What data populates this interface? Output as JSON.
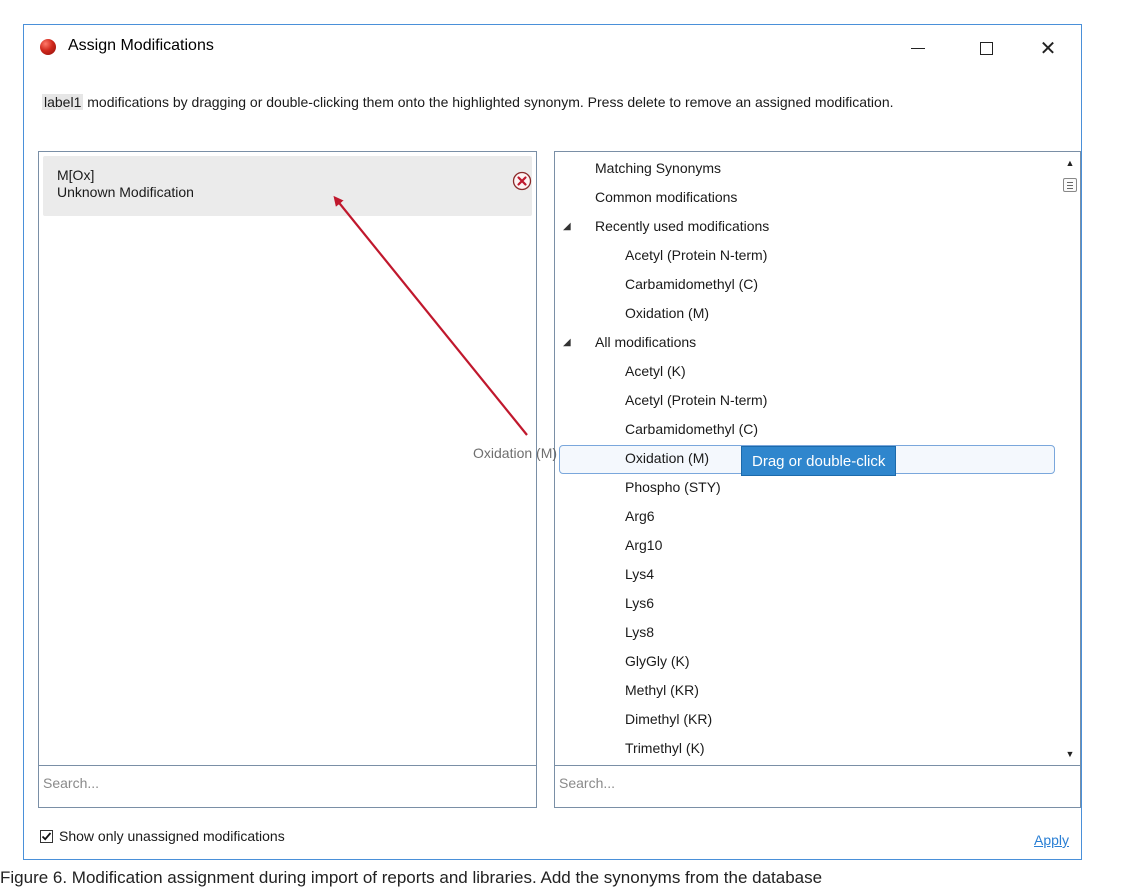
{
  "window": {
    "title": "Assign Modifications",
    "close_glyph": "✕"
  },
  "instruction": {
    "chip": "label1",
    "text": " modifications by dragging  or double-clicking them onto the highlighted synonym. Press delete to remove an assigned modification."
  },
  "left_panel": {
    "card": {
      "name": "M[Ox]",
      "description": "Unknown Modification"
    },
    "search_placeholder": "Search..."
  },
  "right_panel": {
    "tree": [
      {
        "label": "Matching Synonyms",
        "level": 0,
        "expander": ""
      },
      {
        "label": "Common modifications",
        "level": 0,
        "expander": ""
      },
      {
        "label": "Recently used modifications",
        "level": 0,
        "expander": "◢"
      },
      {
        "label": "Acetyl (Protein N-term)",
        "level": 1,
        "expander": ""
      },
      {
        "label": "Carbamidomethyl (C)",
        "level": 1,
        "expander": ""
      },
      {
        "label": "Oxidation (M)",
        "level": 1,
        "expander": ""
      },
      {
        "label": "All modifications",
        "level": 0,
        "expander": "◢"
      },
      {
        "label": "Acetyl (K)",
        "level": 1,
        "expander": ""
      },
      {
        "label": "Acetyl (Protein N-term)",
        "level": 1,
        "expander": ""
      },
      {
        "label": "Carbamidomethyl (C)",
        "level": 1,
        "expander": ""
      },
      {
        "label": "Oxidation (M)",
        "level": 1,
        "expander": ""
      },
      {
        "label": "Phospho (STY)",
        "level": 1,
        "expander": ""
      },
      {
        "label": "Arg6",
        "level": 1,
        "expander": ""
      },
      {
        "label": "Arg10",
        "level": 1,
        "expander": ""
      },
      {
        "label": "Lys4",
        "level": 1,
        "expander": ""
      },
      {
        "label": "Lys6",
        "level": 1,
        "expander": ""
      },
      {
        "label": "Lys8",
        "level": 1,
        "expander": ""
      },
      {
        "label": "GlyGly (K)",
        "level": 1,
        "expander": ""
      },
      {
        "label": "Methyl (KR)",
        "level": 1,
        "expander": ""
      },
      {
        "label": "Dimethyl (KR)",
        "level": 1,
        "expander": ""
      },
      {
        "label": "Trimethyl (K)",
        "level": 1,
        "expander": ""
      }
    ],
    "highlighted_index": 10,
    "tooltip": "Drag or double-click",
    "search_placeholder": "Search..."
  },
  "drag_ghost": "Oxidation (M)",
  "footer": {
    "checkbox_label": "Show only unassigned modifications",
    "checkbox_checked": true,
    "apply_label": "Apply"
  },
  "caption": "Figure 6. Modification assignment during import of reports and libraries. Add the synonyms from the database",
  "colors": {
    "accent": "#2f86cd",
    "arrow": "#c0182d",
    "window_border": "#4a90d9",
    "link": "#2a7fd4"
  },
  "icons": {
    "app": "app-record-icon",
    "remove": "remove-circle-x-icon",
    "scroll_up": "scroll-up-arrow-icon",
    "scroll_down": "scroll-down-arrow-icon",
    "check": "checkmark-icon"
  }
}
